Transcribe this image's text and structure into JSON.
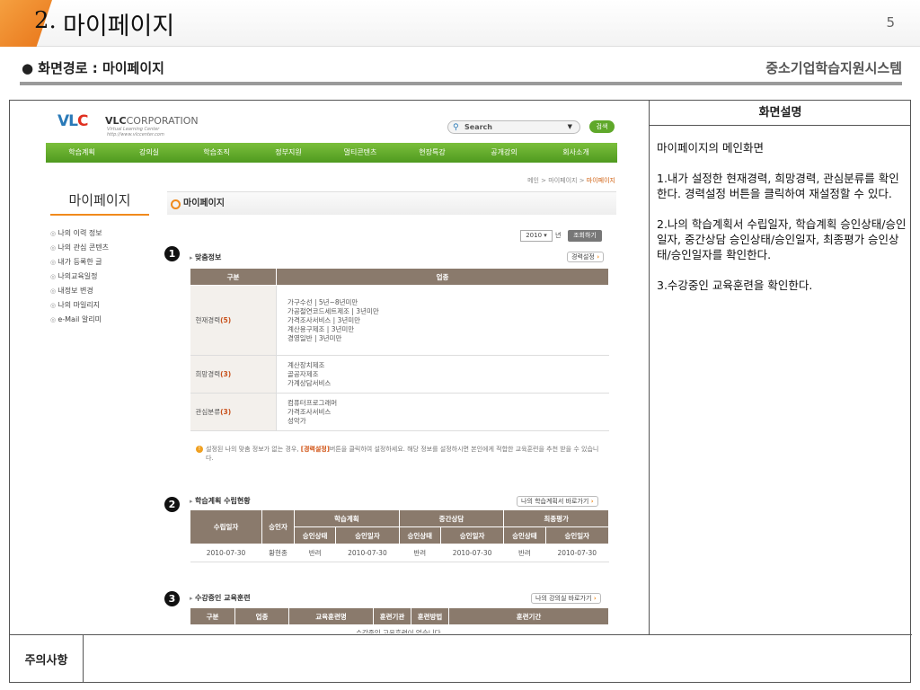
{
  "slide": {
    "number": "2.",
    "title": "마이페이지",
    "page": "5",
    "path_label": "● 화면경로 : 마이페이지",
    "system_name": "중소기업학습지원시스템",
    "desc_header": "화면설명",
    "desc_title": "마이페이지의 메인화면",
    "desc_1": "1.내가 설정한 현재경력, 희망경력, 관심분류를 확인한다. 경력설정 버튼을 클릭하여 재설정할 수 있다.",
    "desc_2": "2.나의 학습계획서 수립일자, 학습계획 승인상태/승인일자, 중간상담 승인상태/승인일자, 최종평가 승인상태/승인일자를 확인한다.",
    "desc_3": "3.수강중인 교육훈련을 확인한다.",
    "note_label": "주의사항"
  },
  "site": {
    "logo": "VLC",
    "corp_bold": "VLC",
    "corp_light": "CORPORATION",
    "corp_sub1": "Virtual Learning Center",
    "corp_sub2": "http://www.vlccenter.com",
    "search_placeholder": "Search",
    "search_button": "검색",
    "nav": [
      "학습계획",
      "강의실",
      "학습조직",
      "정부지원",
      "멀티콘텐츠",
      "현장특강",
      "공개강의",
      "회사소개"
    ],
    "crumb": "메인 > 마이페이지 > ",
    "crumb_current": "마이페이지",
    "lnb_title": "마이페이지",
    "lnb": [
      "나의 이력 정보",
      "나의 관심 콘텐츠",
      "내가 등록한 글",
      "나의교육일정",
      "내정보 변경",
      "나의 마일리지",
      "e-Mail 알리미"
    ],
    "page_title": "마이페이지",
    "year": "2010",
    "year_label": "년",
    "query_button": "조회하기",
    "badges": [
      "1",
      "2",
      "3"
    ],
    "fit": {
      "title": "맞춤정보",
      "button": "경력설정",
      "headers": [
        "구분",
        "업종"
      ],
      "rows": [
        {
          "key": "현재경력",
          "count": "(5)",
          "lines": [
            "가구수선 | 5년~8년미만",
            "가공절연코드세트제조 | 3년미만",
            "가격조사서비스 | 3년미만",
            "계산용구제조 | 3년미만",
            "경영일반 | 3년미만"
          ]
        },
        {
          "key": "희망경력",
          "count": "(3)",
          "lines": [
            "계산장치제조",
            "골공자제조",
            "가계상담서비스"
          ]
        },
        {
          "key": "관심분류",
          "count": "(3)",
          "lines": [
            "컴퓨터프로그래머",
            "가격조사서비스",
            "성악가"
          ]
        }
      ],
      "notice_a": "설정된 나의 맞춤 정보가 없는 경우, ",
      "notice_hl": "[경력설정]",
      "notice_b": "버튼을 클릭하여 설정하세요. 해당 정보를 설정하시면 본인에게 적합한 교육훈련을 추천 받을 수 있습니다."
    },
    "plan": {
      "title": "학습계획 수립현황",
      "button": "나의 학습계획서 바로가기",
      "h_date": "수립일자",
      "h_approver": "승인자",
      "h_plan": "학습계획",
      "h_mid": "중간상담",
      "h_final": "최종평가",
      "h_status": "승인상태",
      "h_appdate": "승인일자",
      "row": [
        "2010-07-30",
        "황현종",
        "반려",
        "2010-07-30",
        "반려",
        "2010-07-30",
        "반려",
        "2010-07-30"
      ]
    },
    "train": {
      "title": "수강중인 교육훈련",
      "button": "나의 강의실 바로가기",
      "headers": [
        "구분",
        "업종",
        "교육훈련명",
        "훈련기관",
        "훈련방법",
        "훈련기간"
      ],
      "empty": "수강중인 교육훈련이 없습니다."
    }
  }
}
